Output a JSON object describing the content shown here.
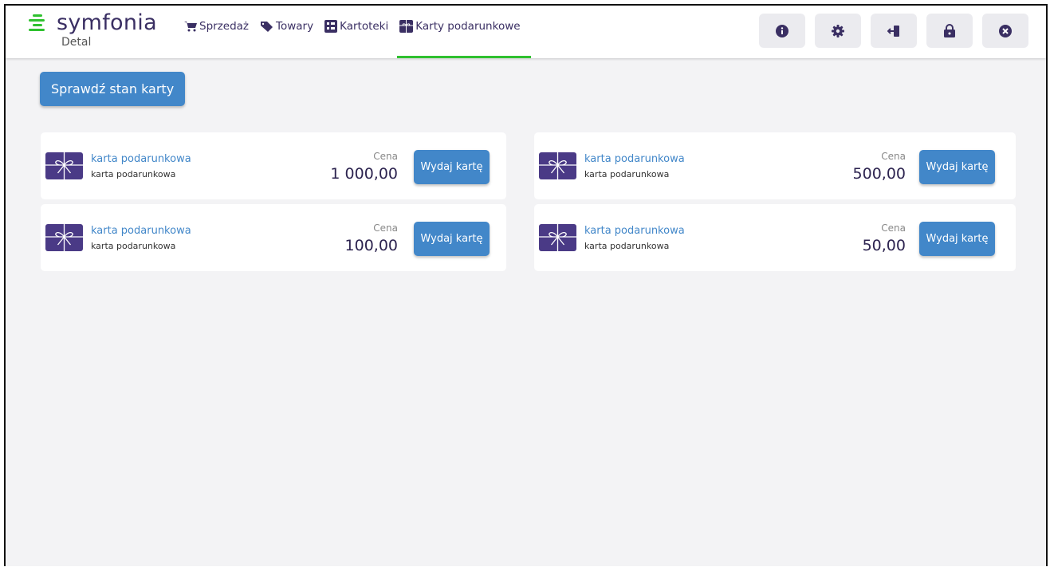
{
  "app": {
    "name": "symfonia",
    "subtitle": "Detal"
  },
  "nav": [
    {
      "label": "Sprzedaż",
      "icon": "cart-icon"
    },
    {
      "label": "Towary",
      "icon": "tag-icon"
    },
    {
      "label": "Kartoteki",
      "icon": "list-icon"
    },
    {
      "label": "Karty podarunkowe",
      "icon": "gift-card-icon",
      "active": true
    }
  ],
  "toolbar": [
    "info-icon",
    "settings-icon",
    "logout-icon",
    "lock-icon",
    "close-icon"
  ],
  "check_button": "Sprawdź stan karty",
  "cards": [
    {
      "title": "karta podarunkowa",
      "subtitle": "karta podarunkowa",
      "price_label": "Cena",
      "price": "1 000,00",
      "button": "Wydaj kartę"
    },
    {
      "title": "karta podarunkowa",
      "subtitle": "karta podarunkowa",
      "price_label": "Cena",
      "price": "500,00",
      "button": "Wydaj kartę"
    },
    {
      "title": "karta podarunkowa",
      "subtitle": "karta podarunkowa",
      "price_label": "Cena",
      "price": "100,00",
      "button": "Wydaj kartę"
    },
    {
      "title": "karta podarunkowa",
      "subtitle": "karta podarunkowa",
      "price_label": "Cena",
      "price": "50,00",
      "button": "Wydaj kartę"
    }
  ],
  "colors": {
    "accent": "#4287c9",
    "brand": "#3a2f63",
    "active_underline": "#2fc12f",
    "logo_green": "#2fc12f"
  }
}
